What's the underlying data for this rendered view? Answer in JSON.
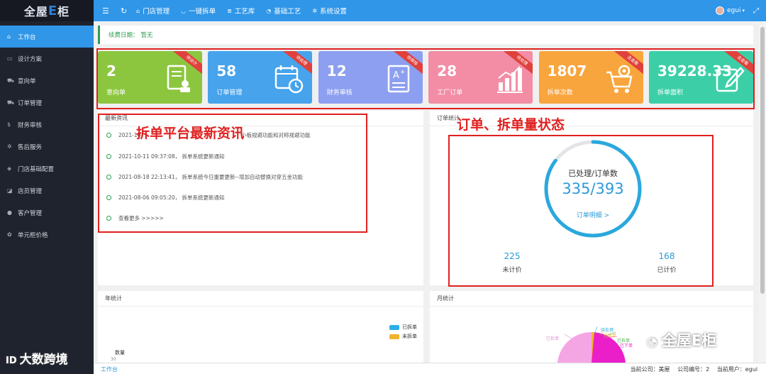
{
  "app": {
    "logo_prefix": "全屋",
    "logo_e": "E",
    "logo_suffix": "柜"
  },
  "sidebar": {
    "items": [
      {
        "label": "工作台",
        "icon": "home-icon",
        "glyph": "⌂",
        "active": true
      },
      {
        "label": "设计方案",
        "icon": "image-icon",
        "glyph": "▭"
      },
      {
        "label": "意向单",
        "icon": "cart-icon",
        "glyph": "⛟"
      },
      {
        "label": "订单管理",
        "icon": "cart-icon",
        "glyph": "⛟"
      },
      {
        "label": "财务审核",
        "icon": "dollar-icon",
        "glyph": "$"
      },
      {
        "label": "售后服务",
        "icon": "gear-icon",
        "glyph": "✲"
      },
      {
        "label": "门店基础配置",
        "icon": "cube-icon",
        "glyph": "◈"
      },
      {
        "label": "店员管理",
        "icon": "staff-icon",
        "glyph": "◪"
      },
      {
        "label": "客户管理",
        "icon": "user-icon",
        "glyph": "●"
      },
      {
        "label": "单元柜价格",
        "icon": "settings-icon",
        "glyph": "✿"
      }
    ]
  },
  "topbar": {
    "nav": [
      {
        "label": "门店管理",
        "icon": "home-icon",
        "glyph": "⌂"
      },
      {
        "label": "一键拆单",
        "icon": "shield-icon",
        "glyph": "◡"
      },
      {
        "label": "工艺库",
        "icon": "bars-icon",
        "glyph": "≣"
      },
      {
        "label": "基础工艺",
        "icon": "palette-icon",
        "glyph": "◔"
      },
      {
        "label": "系统设置",
        "icon": "gear-icon",
        "glyph": "✲"
      }
    ],
    "user": "egui"
  },
  "fee": {
    "label": "续费日期：",
    "value": "暂无"
  },
  "cards": [
    {
      "num": "2",
      "label": "意向单",
      "ribbon": "待设计",
      "color": "#8cc63f",
      "icon": "document-person-icon"
    },
    {
      "num": "58",
      "label": "订单管理",
      "ribbon": "待处理",
      "color": "#46a3ec",
      "icon": "calendar-clock-icon"
    },
    {
      "num": "12",
      "label": "财务审核",
      "ribbon": "待审核",
      "color": "#8c9ff0",
      "icon": "document-grade-icon"
    },
    {
      "num": "28",
      "label": "工厂订单",
      "ribbon": "待处理",
      "color": "#f28da5",
      "icon": "bar-chart-icon"
    },
    {
      "num": "1807",
      "label": "拆单次数",
      "ribbon": "去查看",
      "color": "#f9a53d",
      "icon": "cart-gear-icon"
    },
    {
      "num": "39228.33",
      "label": "拆单面积",
      "ribbon": "去查看",
      "color": "#3ccfa7",
      "icon": "edit-icon"
    }
  ],
  "news": {
    "title": "最新资讯",
    "items": [
      {
        "text": "2021-10-",
        "tail": "小板规避功能和对称规避功能"
      },
      {
        "text": "2021-10-11 09:37:08，  拆单系统更新通知"
      },
      {
        "text": "2021-08-18 22:13:41，  拆单系统今日重要更新--增加自动替换对穿五金功能"
      },
      {
        "text": "2021-08-06 09:05:20，  拆单系统更新通知"
      }
    ],
    "more": "查看更多 >>>>>",
    "annotation": "拆单平台最新资讯"
  },
  "orders": {
    "title": "订单统计",
    "annotation": "订单、拆单量状态",
    "ring_label": "已处理/订单数",
    "processed": 335,
    "total": 393,
    "ratio": "335/393",
    "detail_link": "订单明细 >",
    "left_value": "225",
    "left_label": "未计价",
    "right_value": "168",
    "right_label": "已计价"
  },
  "year": {
    "title": "年统计",
    "legend": [
      "已拆单",
      "未拆单"
    ],
    "legend_colors": [
      "#2ab0e6",
      "#f2b32c"
    ],
    "ylabel": "数量",
    "ytick": "30"
  },
  "month": {
    "title": "月统计",
    "labels": [
      "待处理",
      "已接单",
      "已拆单",
      "已下单"
    ]
  },
  "footer": {
    "tab": "工作台",
    "company_label": "当前公司：",
    "company": "美屋",
    "code_label": "公司编号：",
    "code": "2",
    "user_label": "当前用户：",
    "user": "egui"
  },
  "watermarks": {
    "left": "大数跨境",
    "right": "全屋E柜"
  }
}
